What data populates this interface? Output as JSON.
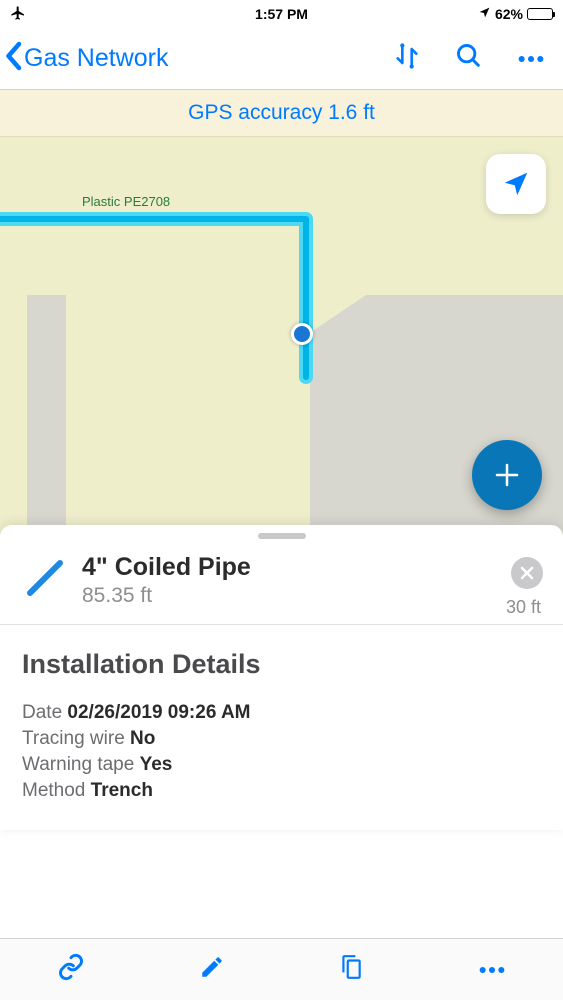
{
  "status_bar": {
    "time": "1:57 PM",
    "battery_percent": "62%"
  },
  "nav": {
    "back_label": "Gas Network"
  },
  "banner": {
    "text": "GPS accuracy 1.6 ft"
  },
  "map": {
    "pipe_label": "Plastic PE2708"
  },
  "feature": {
    "title": "4\" Coiled Pipe",
    "length": "85.35 ft",
    "distance": "30 ft"
  },
  "details": {
    "section_title": "Installation Details",
    "rows": [
      {
        "label": "Date",
        "value": "02/26/2019 09:26 AM"
      },
      {
        "label": "Tracing wire",
        "value": "No"
      },
      {
        "label": "Warning tape",
        "value": "Yes"
      },
      {
        "label": "Method",
        "value": "Trench"
      }
    ]
  }
}
